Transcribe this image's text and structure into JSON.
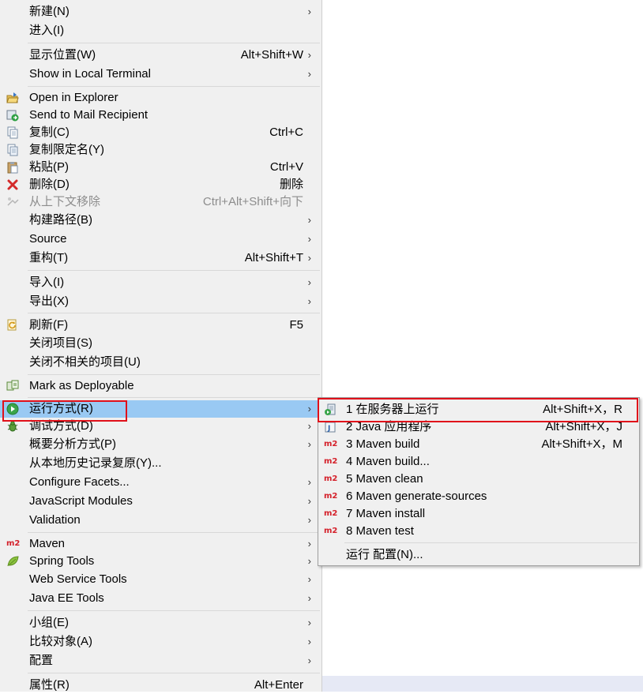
{
  "main_menu": {
    "items": [
      {
        "label": "新建(N)",
        "accel": "",
        "submenu": true,
        "icon": "",
        "disabled": false
      },
      {
        "label": "进入(I)",
        "accel": "",
        "submenu": false,
        "icon": "",
        "disabled": false
      },
      {
        "label": "显示位置(W)",
        "accel": "Alt+Shift+W",
        "submenu": true,
        "icon": "",
        "disabled": false
      },
      {
        "label": "Show in Local Terminal",
        "accel": "",
        "submenu": true,
        "icon": "",
        "disabled": false
      },
      {
        "label": "Open in Explorer",
        "accel": "",
        "submenu": false,
        "icon": "open-in-explorer-icon",
        "disabled": false
      },
      {
        "label": "Send to Mail Recipient",
        "accel": "",
        "submenu": false,
        "icon": "send-mail-icon",
        "disabled": false
      },
      {
        "label": "复制(C)",
        "accel": "Ctrl+C",
        "submenu": false,
        "icon": "copy-icon",
        "disabled": false
      },
      {
        "label": "复制限定名(Y)",
        "accel": "",
        "submenu": false,
        "icon": "copy-qualified-name-icon",
        "disabled": false
      },
      {
        "label": "粘贴(P)",
        "accel": "Ctrl+V",
        "submenu": false,
        "icon": "paste-icon",
        "disabled": false
      },
      {
        "label": "删除(D)",
        "accel": "删除",
        "submenu": false,
        "icon": "delete-icon",
        "disabled": false
      },
      {
        "label": "从上下文移除",
        "accel": "Ctrl+Alt+Shift+向下",
        "submenu": false,
        "icon": "remove-from-context-icon",
        "disabled": true
      },
      {
        "label": "构建路径(B)",
        "accel": "",
        "submenu": true,
        "icon": "",
        "disabled": false
      },
      {
        "label": "Source",
        "accel": "",
        "submenu": true,
        "icon": "",
        "disabled": false
      },
      {
        "label": "重构(T)",
        "accel": "Alt+Shift+T",
        "submenu": true,
        "icon": "",
        "disabled": false
      },
      {
        "label": "导入(I)",
        "accel": "",
        "submenu": true,
        "icon": "",
        "disabled": false
      },
      {
        "label": "导出(X)",
        "accel": "",
        "submenu": true,
        "icon": "",
        "disabled": false
      },
      {
        "label": "刷新(F)",
        "accel": "F5",
        "submenu": false,
        "icon": "refresh-icon",
        "disabled": false
      },
      {
        "label": "关闭项目(S)",
        "accel": "",
        "submenu": false,
        "icon": "",
        "disabled": false
      },
      {
        "label": "关闭不相关的项目(U)",
        "accel": "",
        "submenu": false,
        "icon": "",
        "disabled": false
      },
      {
        "label": "Mark as Deployable",
        "accel": "",
        "submenu": false,
        "icon": "deployable-icon",
        "disabled": false
      },
      {
        "label": "运行方式(R)",
        "accel": "",
        "submenu": true,
        "icon": "run-icon",
        "disabled": false,
        "selected": true
      },
      {
        "label": "调试方式(D)",
        "accel": "",
        "submenu": true,
        "icon": "debug-icon",
        "disabled": false
      },
      {
        "label": "概要分析方式(P)",
        "accel": "",
        "submenu": true,
        "icon": "",
        "disabled": false
      },
      {
        "label": "从本地历史记录复原(Y)...",
        "accel": "",
        "submenu": false,
        "icon": "",
        "disabled": false
      },
      {
        "label": "Configure Facets...",
        "accel": "",
        "submenu": true,
        "icon": "",
        "disabled": false
      },
      {
        "label": "JavaScript Modules",
        "accel": "",
        "submenu": true,
        "icon": "",
        "disabled": false
      },
      {
        "label": "Validation",
        "accel": "",
        "submenu": true,
        "icon": "",
        "disabled": false
      },
      {
        "label": "Maven",
        "accel": "",
        "submenu": true,
        "icon": "maven-m2-icon",
        "disabled": false
      },
      {
        "label": "Spring Tools",
        "accel": "",
        "submenu": true,
        "icon": "spring-leaf-icon",
        "disabled": false
      },
      {
        "label": "Web Service Tools",
        "accel": "",
        "submenu": true,
        "icon": "",
        "disabled": false
      },
      {
        "label": "Java EE Tools",
        "accel": "",
        "submenu": true,
        "icon": "",
        "disabled": false
      },
      {
        "label": "小组(E)",
        "accel": "",
        "submenu": true,
        "icon": "",
        "disabled": false
      },
      {
        "label": "比较对象(A)",
        "accel": "",
        "submenu": true,
        "icon": "",
        "disabled": false
      },
      {
        "label": "配置",
        "accel": "",
        "submenu": true,
        "icon": "",
        "disabled": false
      },
      {
        "label": "属性(R)",
        "accel": "Alt+Enter",
        "submenu": false,
        "icon": "",
        "disabled": false
      }
    ]
  },
  "run_as_menu": {
    "items": [
      {
        "label": "1 在服务器上运行",
        "accel": "Alt+Shift+X，R",
        "icon": "run-on-server-icon"
      },
      {
        "label": "2 Java 应用程序",
        "accel": "Alt+Shift+X，J",
        "icon": "java-app-icon"
      },
      {
        "label": "3 Maven build",
        "accel": "Alt+Shift+X，M",
        "icon": "maven-m2-icon"
      },
      {
        "label": "4 Maven build...",
        "accel": "",
        "icon": "maven-m2-icon"
      },
      {
        "label": "5 Maven clean",
        "accel": "",
        "icon": "maven-m2-icon"
      },
      {
        "label": "6 Maven generate-sources",
        "accel": "",
        "icon": "maven-m2-icon"
      },
      {
        "label": "7 Maven install",
        "accel": "",
        "icon": "maven-m2-icon"
      },
      {
        "label": "8 Maven test",
        "accel": "",
        "icon": "maven-m2-icon"
      },
      {
        "label": "运行 配置(N)...",
        "accel": "",
        "icon": ""
      }
    ]
  },
  "m2_text": "m2",
  "colors": {
    "selection": "#99c9f3",
    "highlight_box": "#e0101a",
    "menu_bg": "#f0f0f0"
  }
}
